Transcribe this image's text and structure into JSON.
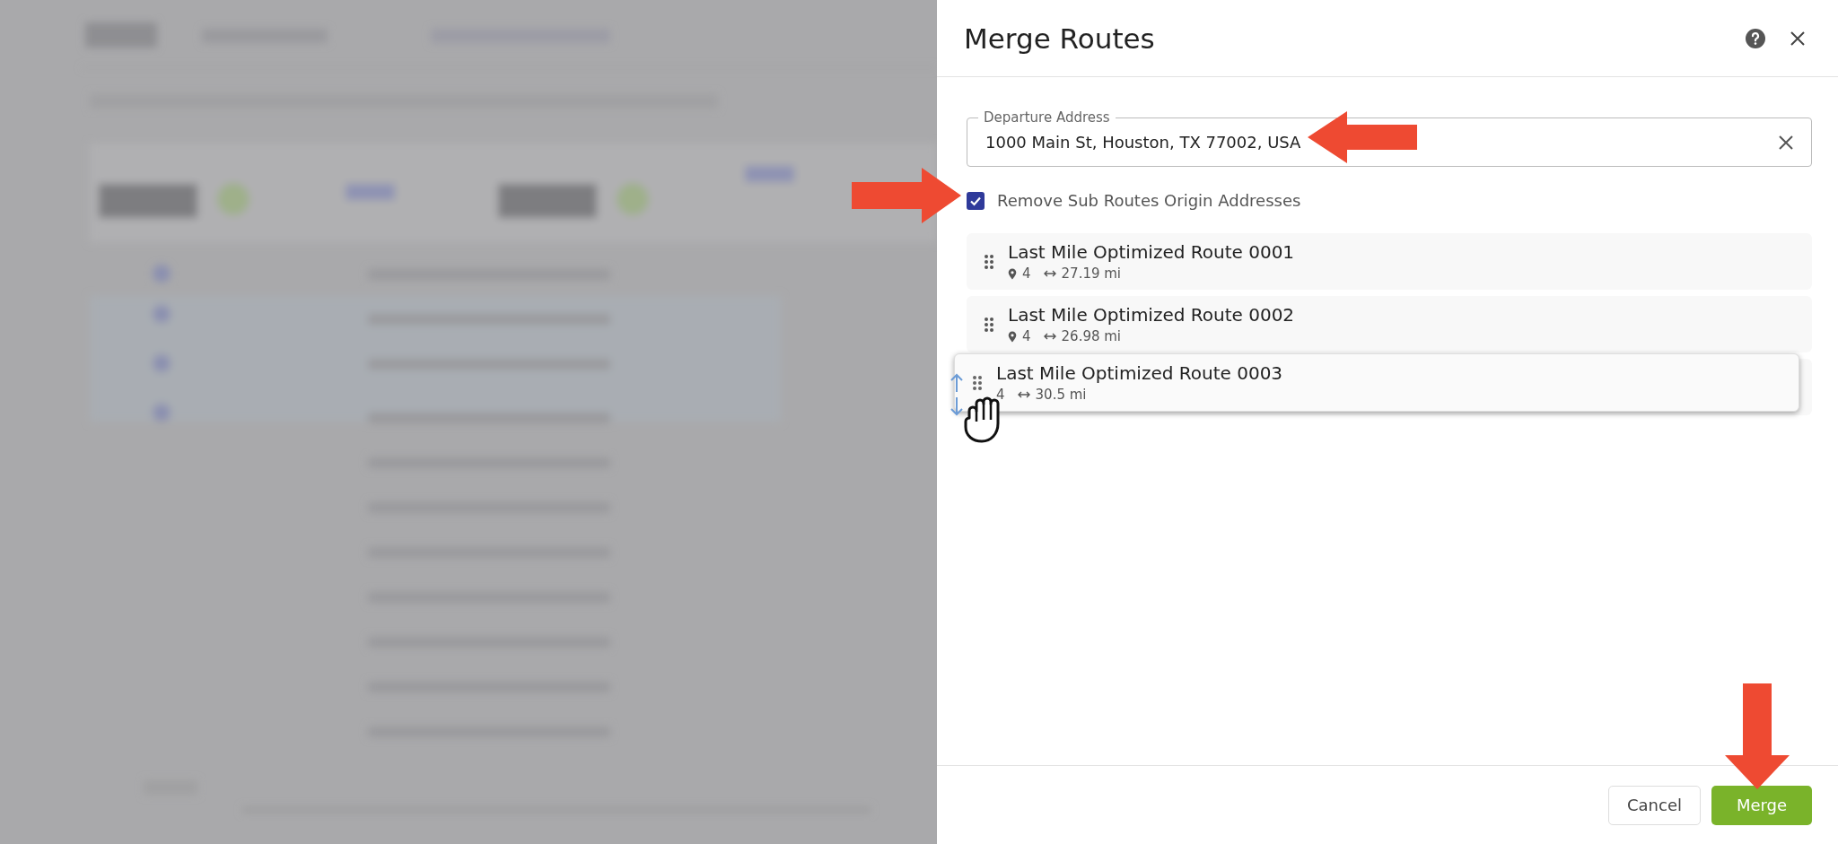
{
  "dialog": {
    "title": "Merge Routes"
  },
  "departure": {
    "label": "Departure Address",
    "value": "1000 Main St, Houston, TX 77002, USA"
  },
  "remove_origins": {
    "label": "Remove Sub Routes Origin Addresses",
    "checked": true
  },
  "routes": [
    {
      "name": "Last Mile Optimized Route 0001",
      "stops": "4",
      "distance": "27.19 mi",
      "dragging": false
    },
    {
      "name": "Last Mile Optimized Route 0002",
      "stops": "4",
      "distance": "26.98 mi",
      "dragging": false
    },
    {
      "name": "Last Mile Optimized Route 0003",
      "stops": "4",
      "distance": "30.5 mi",
      "dragging": true
    }
  ],
  "buttons": {
    "cancel": "Cancel",
    "merge": "Merge"
  }
}
